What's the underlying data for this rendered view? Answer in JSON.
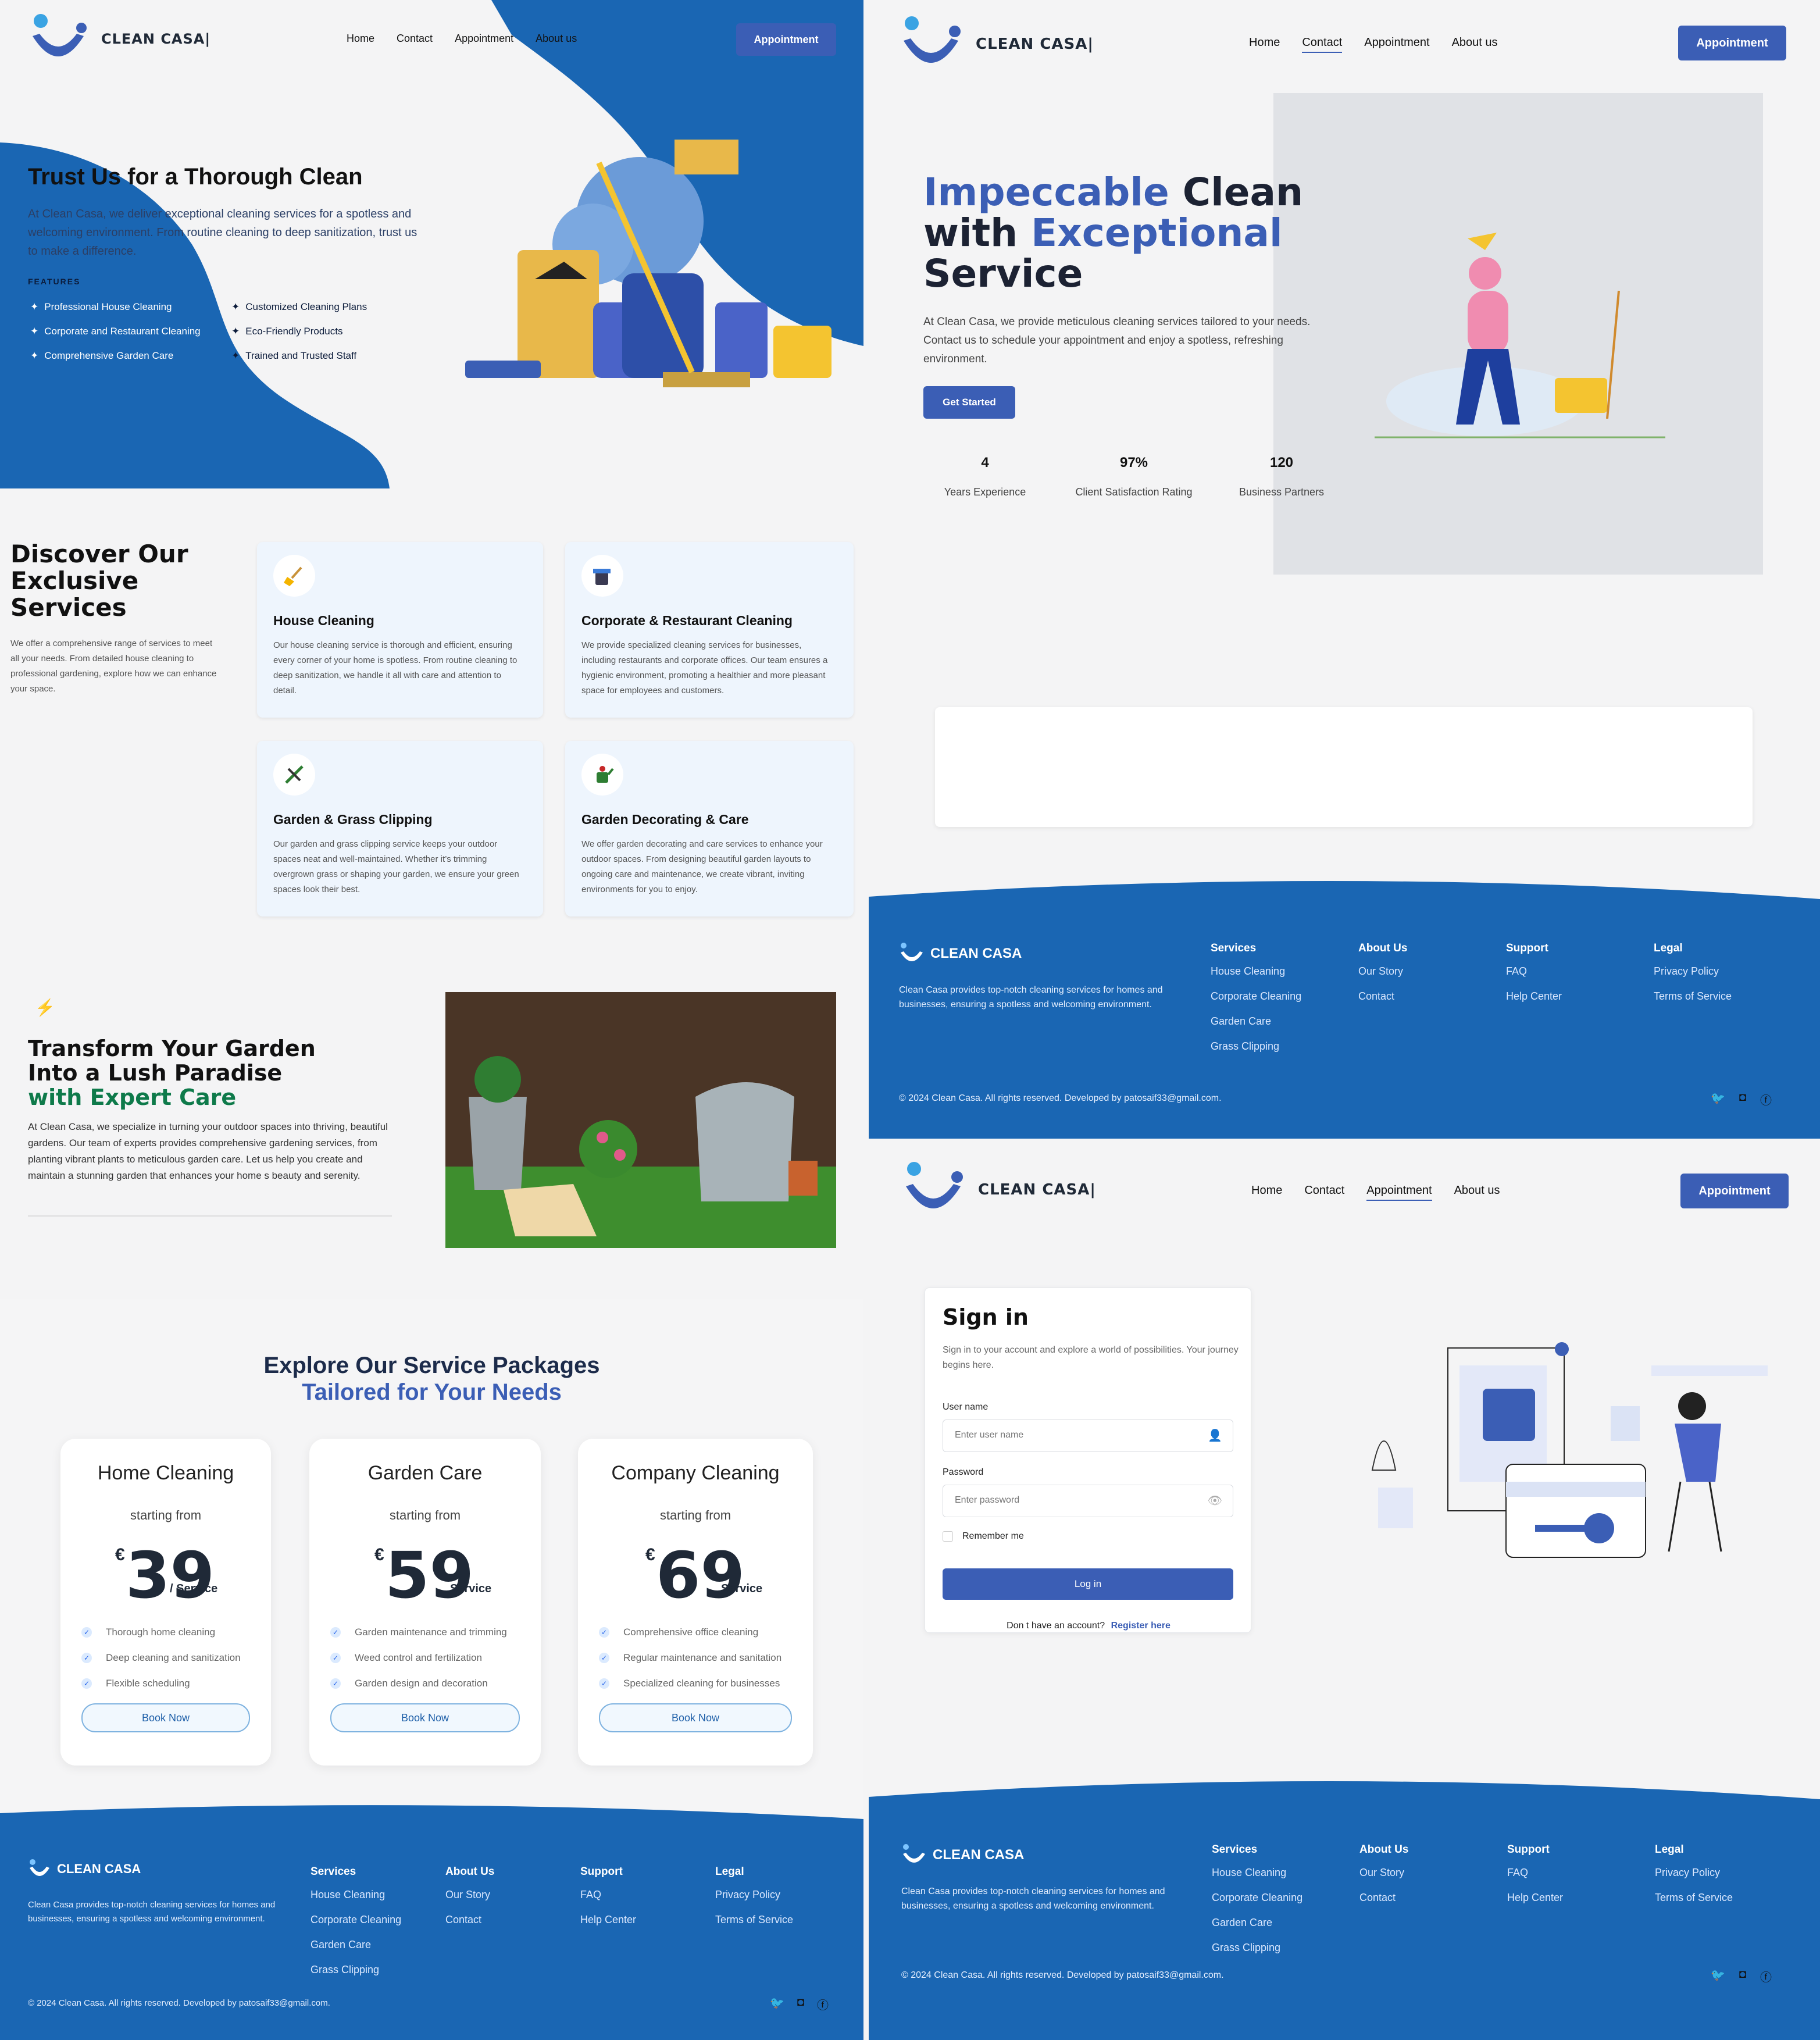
{
  "brand": {
    "name": "CLEAN CASA|",
    "footer_name": "CLEAN CASA"
  },
  "nav": {
    "home": "Home",
    "contact": "Contact",
    "appointment": "Appointment",
    "about": "About us",
    "cta": "Appointment"
  },
  "hero_left": {
    "title": "Trust Us for a Thorough Clean",
    "description": "At Clean Casa, we deliver exceptional cleaning services for a spotless and welcoming environment. From routine cleaning to deep sanitization, trust us to make a difference.",
    "features_heading": "FEATURES",
    "features": [
      "Professional House Cleaning",
      "Corporate and Restaurant Cleaning",
      "Comprehensive Garden Care",
      "Customized Cleaning Plans",
      "Eco-Friendly Products",
      "Trained and Trusted Staff"
    ]
  },
  "services": {
    "title": "Discover Our Exclusive Services",
    "description": "We offer a comprehensive range of services to meet all your needs. From detailed house cleaning to professional gardening, explore how we can enhance your space.",
    "cards": [
      {
        "icon": "broom-icon",
        "title": "House Cleaning",
        "text": "Our house cleaning service is thorough and efficient, ensuring every corner of your home is spotless. From routine cleaning to deep sanitization, we handle it all with care and attention to detail."
      },
      {
        "icon": "bucket-icon",
        "title": "Corporate & Restaurant Cleaning",
        "text": "We provide specialized cleaning services for businesses, including restaurants and corporate offices. Our team ensures a hygienic environment, promoting a healthier and more pleasant space for employees and customers."
      },
      {
        "icon": "shears-icon",
        "title": "Garden & Grass Clipping",
        "text": "Our garden and grass clipping service keeps your outdoor spaces neat and well-maintained. Whether it’s trimming overgrown grass or shaping your garden, we ensure your green spaces look their best."
      },
      {
        "icon": "watering-can-icon",
        "title": "Garden Decorating & Care",
        "text": "We offer garden decorating and care services to enhance your outdoor spaces. From designing beautiful garden layouts to ongoing care and maintenance, we create vibrant, inviting environments for you to enjoy."
      }
    ]
  },
  "garden": {
    "title_line1": "Transform Your Garden",
    "title_line2": "Into a Lush Paradise",
    "title_line3": "with Expert Care",
    "text": "At Clean Casa, we specialize in turning your outdoor spaces into thriving, beautiful gardens. Our team of experts provides comprehensive gardening services, from planting vibrant plants to meticulous garden care. Let us help you create and maintain a stunning garden that enhances your home s beauty and serenity."
  },
  "packages": {
    "title": "Explore Our Service Packages",
    "subtitle": "Tailored for Your Needs",
    "items": [
      {
        "name": "Home Cleaning",
        "from": "starting from",
        "currency": "€",
        "price": "39",
        "per": "/ Service",
        "features": [
          "Thorough home cleaning",
          "Deep cleaning and sanitization",
          "Flexible scheduling"
        ],
        "cta": "Book Now"
      },
      {
        "name": "Garden Care",
        "from": "starting from",
        "currency": "€",
        "price": "59",
        "per": "Service",
        "features": [
          "Garden maintenance and trimming",
          "Weed control and fertilization",
          "Garden design and decoration"
        ],
        "cta": "Book Now"
      },
      {
        "name": "Company Cleaning",
        "from": "starting from",
        "currency": "€",
        "price": "69",
        "per": "Service",
        "features": [
          "Comprehensive office cleaning",
          "Regular maintenance and sanitation",
          "Specialized cleaning for businesses"
        ],
        "cta": "Book Now"
      }
    ]
  },
  "hero_right": {
    "title_a": "Impeccable",
    "title_b": "Clean",
    "title_c": "with",
    "title_d": "Exceptional",
    "title_e": "Service",
    "text": "At Clean Casa, we provide meticulous cleaning services tailored to your needs. Contact us to schedule your appointment and enjoy a spotless, refreshing environment.",
    "cta": "Get Started",
    "stats": [
      {
        "value": "4",
        "label": "Years Experience"
      },
      {
        "value": "97%",
        "label": "Client Satisfaction Rating"
      },
      {
        "value": "120",
        "label": "Business Partners"
      }
    ]
  },
  "signin": {
    "title": "Sign in",
    "subtitle": "Sign in to your account and explore a world of possibilities. Your journey begins here.",
    "user_label": "User name",
    "user_placeholder": "Enter user name",
    "pass_label": "Password",
    "pass_placeholder": "Enter password",
    "remember": "Remember me",
    "login": "Log in",
    "no_account": "Don t have an account?",
    "register": "Register here"
  },
  "footer": {
    "about": "Clean Casa provides top-notch cleaning services for homes and businesses, ensuring a spotless and welcoming environment.",
    "services": {
      "title": "Services",
      "items": [
        "House Cleaning",
        "Corporate Cleaning",
        "Garden Care",
        "Grass Clipping"
      ]
    },
    "aboutus": {
      "title": "About Us",
      "items": [
        "Our Story",
        "Contact"
      ]
    },
    "support": {
      "title": "Support",
      "items": [
        "FAQ",
        "Help Center"
      ]
    },
    "legal": {
      "title": "Legal",
      "items": [
        "Privacy Policy",
        "Terms of Service"
      ]
    },
    "copyright": "© 2024 Clean Casa. All rights reserved. Developed by patosaif33@gmail.com.",
    "social": [
      "twitter-icon",
      "instagram-icon",
      "facebook-icon"
    ]
  },
  "colors": {
    "primary": "#1a66b3",
    "button": "#3b5eb5",
    "accent_green": "#0e7a4a",
    "hero_blue": "#3b5eb5"
  }
}
